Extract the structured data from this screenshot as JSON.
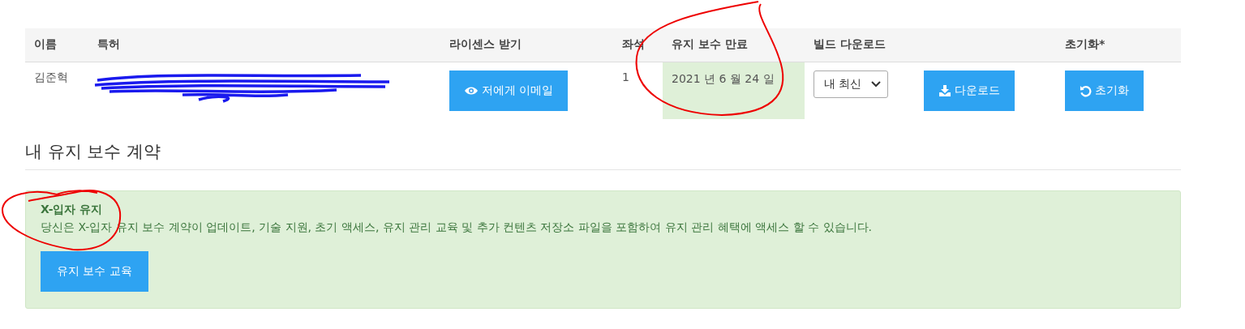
{
  "table": {
    "columns": [
      "이름",
      "특허",
      "라이센스 받기",
      "좌석",
      "유지 보수 만료",
      "빌드 다운로드",
      "",
      "초기화*"
    ],
    "rows": [
      {
        "name": "김준혁",
        "patent_redacted": true,
        "email_button": "저에게 이메일",
        "seats": "1",
        "expiry": "2021 년 6 월 24 일",
        "expiry_highlighted": true,
        "build_select": "내 최신",
        "download_button": "다운로드",
        "reset_button": "초기화"
      }
    ]
  },
  "section": {
    "title": "내 유지 보수 계약"
  },
  "alert": {
    "title": "X-입자 유지",
    "text": "당신은 X-입자 유지 보수 계약이 업데이트, 기술 지원, 초기 액세스, 유지 관리 교육 및 추가 컨텐츠 저장소 파일을 포함하여 유지 관리 혜택에 액세스 할 수 있습니다.",
    "button": "유지 보수 교육"
  },
  "annotations": [
    {
      "kind": "circle"
    },
    {
      "kind": "circle"
    }
  ]
}
